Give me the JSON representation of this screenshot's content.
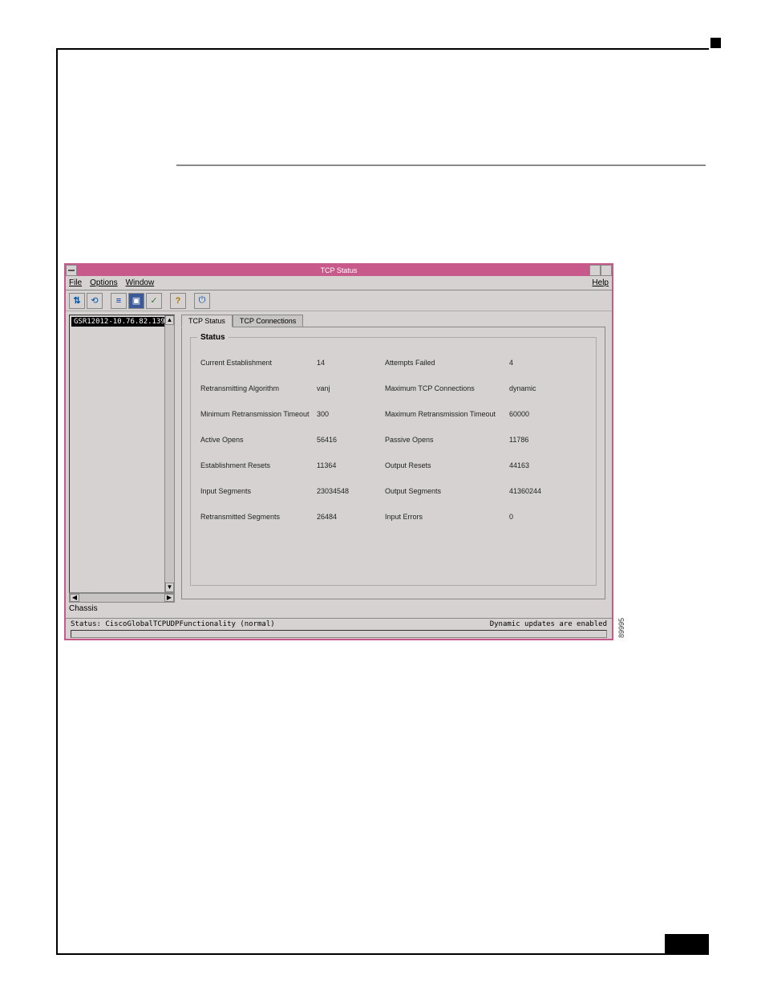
{
  "window": {
    "title": "TCP Status"
  },
  "menubar": {
    "file": "File",
    "options": "Options",
    "window": "Window",
    "help": "Help"
  },
  "toolbar": {
    "icons": [
      "⇵",
      "⟳",
      "≡",
      "▣",
      "✓",
      "?",
      "⏻"
    ]
  },
  "tree": {
    "item": "GSR12012-10.76.82.139",
    "label": "Chassis"
  },
  "tabs": {
    "active": "TCP Status",
    "other": "TCP Connections"
  },
  "fieldset": {
    "legend": "Status"
  },
  "status": {
    "r1": {
      "l1": "Current Establishment",
      "v1": "14",
      "l2": "Attempts Failed",
      "v2": "4"
    },
    "r2": {
      "l1": "Retransmitting Algorithm",
      "v1": "vanj",
      "l2": "Maximum TCP Connections",
      "v2": "dynamic"
    },
    "r3": {
      "l1": "Minimum Retransmission Timeout",
      "v1": "300",
      "l2": "Maximum Retransmission Timeout",
      "v2": "60000"
    },
    "r4": {
      "l1": "Active Opens",
      "v1": "56416",
      "l2": "Passive Opens",
      "v2": "11786"
    },
    "r5": {
      "l1": "Establishment Resets",
      "v1": "11364",
      "l2": "Output Resets",
      "v2": "44163"
    },
    "r6": {
      "l1": "Input Segments",
      "v1": "23034548",
      "l2": "Output Segments",
      "v2": "41360244"
    },
    "r7": {
      "l1": "Retransmitted Segments",
      "v1": "26484",
      "l2": "Input Errors",
      "v2": "0"
    }
  },
  "statusbar": {
    "left": "Status: CiscoGlobalTCPUDPFunctionality (normal)",
    "right": "Dynamic updates are enabled"
  },
  "sidelabel": "89995"
}
